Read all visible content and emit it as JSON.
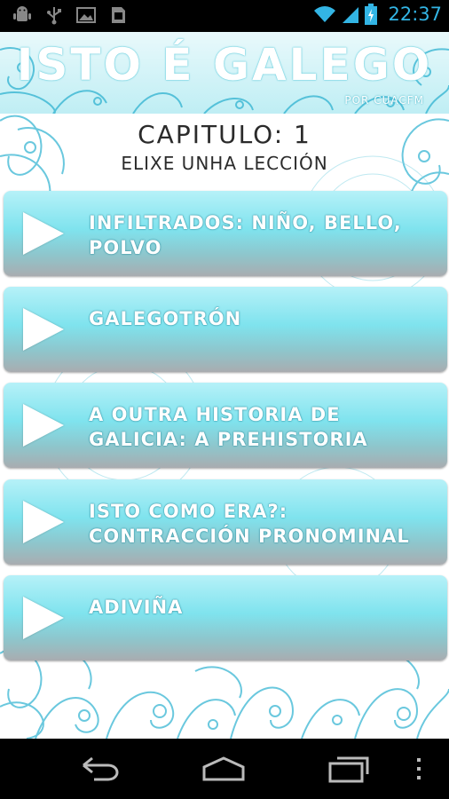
{
  "status_bar": {
    "time": "22:37",
    "left_icons": [
      "android-debug-icon",
      "usb-icon",
      "image-icon",
      "sd-card-icon"
    ],
    "right_icons": [
      "wifi-icon",
      "signal-icon",
      "battery-icon"
    ]
  },
  "header": {
    "title": "ISTO É GALEGO",
    "byline": "POR CUACFM"
  },
  "chapter": {
    "title": "CAPITULO: 1",
    "subtitle": "ELIXE UNHA LECCIÓN"
  },
  "lessons": [
    {
      "label": "INFILTRADOS: NIÑO, BELLO, POLVO"
    },
    {
      "label": "GALEGOTRÓN"
    },
    {
      "label": "A OUTRA HISTORIA DE GALICIA: A PREHISTORIA"
    },
    {
      "label": "ISTO COMO ERA?: CONTRACCIÓN PRONOMINAL"
    },
    {
      "label": "ADIVIÑA"
    }
  ],
  "nav_bar": {
    "buttons": [
      "back-icon",
      "home-icon",
      "recent-apps-icon",
      "menu-icon"
    ]
  },
  "colors": {
    "accent": "#33b5e5",
    "card_top": "#b6f1f8",
    "card_mid": "#7fe3ee",
    "card_bottom": "#a9acb0",
    "ornament": "#39b6d3"
  }
}
